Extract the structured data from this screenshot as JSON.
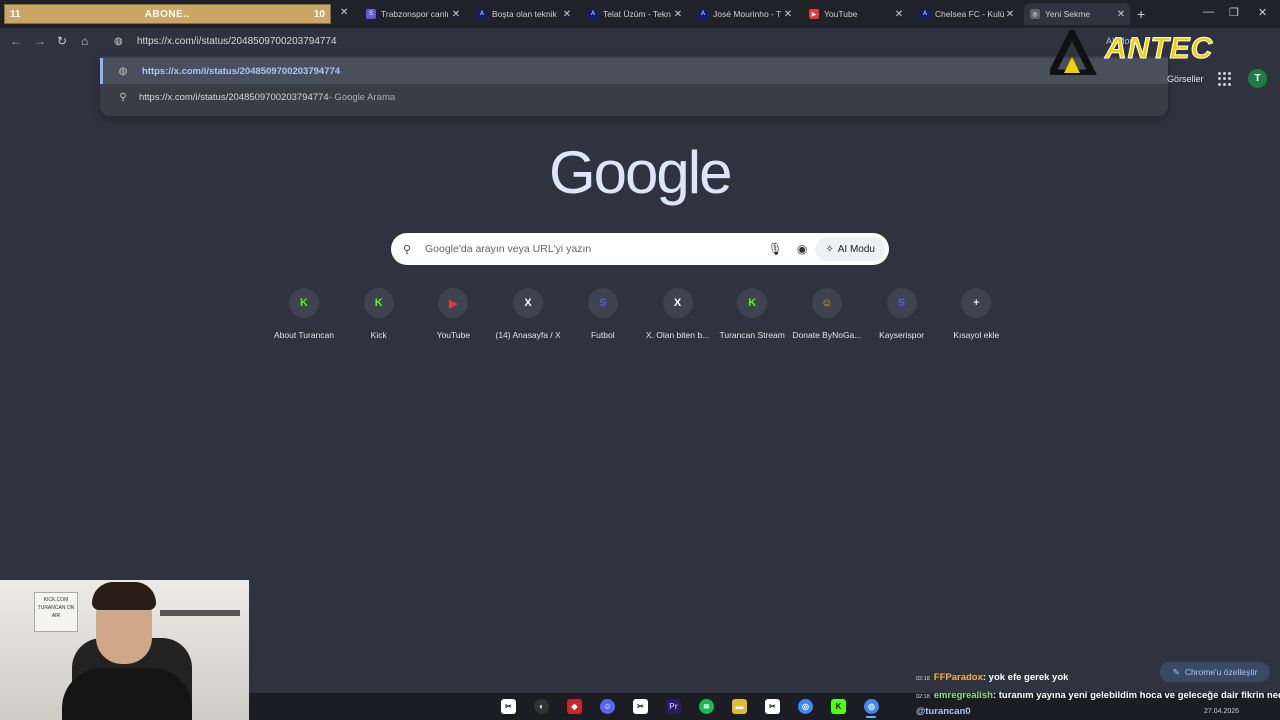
{
  "subscriber_bar": {
    "left": "11",
    "label": "ABONE..",
    "right": "10"
  },
  "tabs": [
    {
      "label": "Trabzonspor canlı",
      "favicon": "S",
      "favcolor": "#5b5bdc"
    },
    {
      "label": "Boşta olan teknik",
      "favicon": "A",
      "favcolor": "#101a6e"
    },
    {
      "label": "Telat Üzüm - Tekn",
      "favicon": "A",
      "favcolor": "#101a6e"
    },
    {
      "label": "José Mourinho - T",
      "favicon": "A",
      "favcolor": "#101a6e"
    },
    {
      "label": "YouTube",
      "favicon": "▶",
      "favcolor": "#e53935"
    },
    {
      "label": "Chelsea FC - Kulü",
      "favicon": "A",
      "favcolor": "#101a6e"
    },
    {
      "label": "Yeni Sekme",
      "favicon": "◎",
      "favcolor": "#5f6368"
    }
  ],
  "omnibox": {
    "text": "https://x.com/i/status/2048509700203794774"
  },
  "suggestions": [
    {
      "text": "https://x.com/i/status/2048509700203794774",
      "suffix": ""
    },
    {
      "text": "https://x.com/i/status/2048509700203794774",
      "suffix": " - Google Arama"
    }
  ],
  "header": {
    "images": "Görseller",
    "avatar": "T"
  },
  "overlay": {
    "brand": "ANTEC",
    "ai_mode": "AI Modu"
  },
  "google": {
    "logo": "Google",
    "search_placeholder": "Google'da arayın veya URL'yi yazın",
    "ai_mode": "AI Modu"
  },
  "shortcuts": [
    {
      "label": "About Turancan",
      "glyph": "K",
      "color": "#53fc18"
    },
    {
      "label": "Kick",
      "glyph": "K",
      "color": "#53fc18"
    },
    {
      "label": "YouTube",
      "glyph": "▶",
      "color": "#e53935"
    },
    {
      "label": "(14) Anasayfa / X",
      "glyph": "X",
      "color": "#ffffff"
    },
    {
      "label": "Futbol",
      "glyph": "S",
      "color": "#5b5bdc"
    },
    {
      "label": "X. Olan biten b...",
      "glyph": "X",
      "color": "#ffffff"
    },
    {
      "label": "Turancan Stream",
      "glyph": "K",
      "color": "#53fc18"
    },
    {
      "label": "Donate ByNoGa...",
      "glyph": "☺",
      "color": "#f5b400"
    },
    {
      "label": "Kayserispor",
      "glyph": "S",
      "color": "#5b5bdc"
    },
    {
      "label": "Kısayol ekle",
      "glyph": "+",
      "color": "#e3e3e3"
    }
  ],
  "webcam": {
    "sign_text": "KICK.COM TURANCAN ON AIR"
  },
  "customize": "Chrome'u özelleştir",
  "chat": [
    {
      "time": "02:18",
      "user": "FFParadox",
      "user_color": "#f5b043",
      "msg": ": yok efe gerek yok"
    },
    {
      "time": "02:18",
      "user": "emregrealish",
      "user_color": "#8ee07a",
      "msg": ": turanım yayına yeni gelebildim hoca ve geleceğe dair fikrin nedir"
    },
    {
      "time": "",
      "user": "@turancan0",
      "user_color": "#a8c7fa",
      "msg": ""
    }
  ],
  "clock": {
    "date": "27.04.2026"
  }
}
